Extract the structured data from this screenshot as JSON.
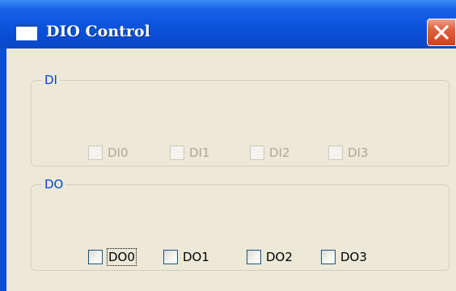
{
  "window": {
    "title": "DIO Control"
  },
  "di_group": {
    "legend": "DI",
    "items": [
      {
        "label": "DI0",
        "checked": false,
        "enabled": false
      },
      {
        "label": "DI1",
        "checked": false,
        "enabled": false
      },
      {
        "label": "DI2",
        "checked": false,
        "enabled": false
      },
      {
        "label": "DI3",
        "checked": false,
        "enabled": false
      }
    ]
  },
  "do_group": {
    "legend": "DO",
    "items": [
      {
        "label": "DO0",
        "checked": false,
        "enabled": true,
        "focused": true
      },
      {
        "label": "DO1",
        "checked": false,
        "enabled": true
      },
      {
        "label": "DO2",
        "checked": false,
        "enabled": true
      },
      {
        "label": "DO3",
        "checked": false,
        "enabled": true
      }
    ]
  },
  "colors": {
    "titlebar": "#0a4fd6",
    "client": "#ece9d8",
    "legend": "#0046d5",
    "close": "#e06040"
  },
  "icons": {
    "title": "window-icon",
    "close": "close-icon"
  }
}
